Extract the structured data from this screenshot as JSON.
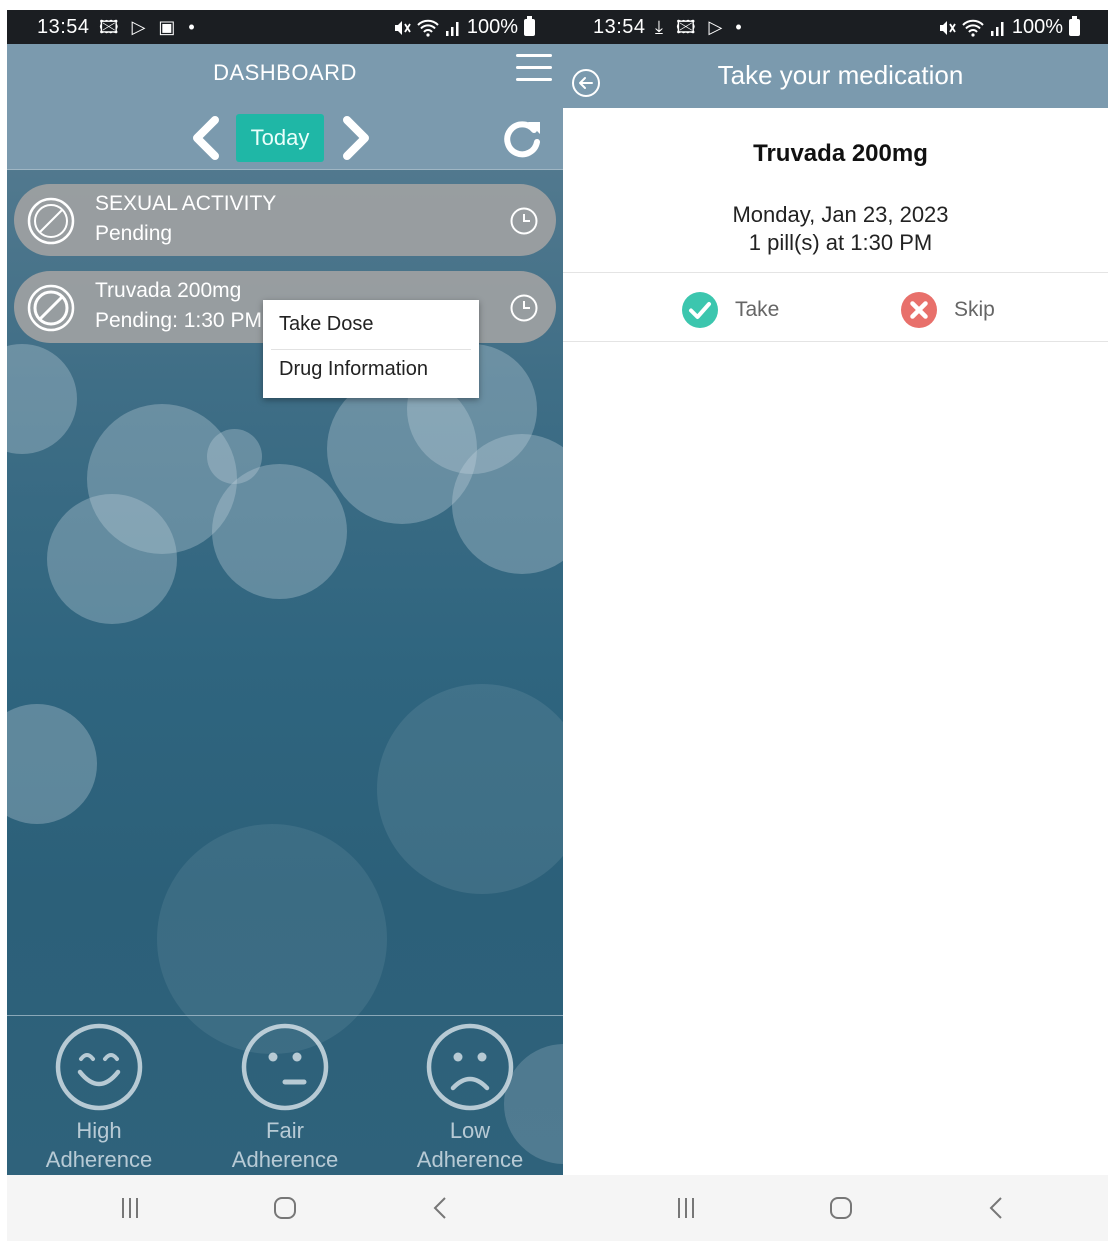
{
  "left_screen": {
    "status": {
      "time": "13:54",
      "left_icons": "🖾 ▷ ▣ •",
      "battery": "100%"
    },
    "header": {
      "title": "DASHBOARD",
      "today_label": "Today"
    },
    "medications": [
      {
        "name": "SEXUAL ACTIVITY",
        "status": "Pending"
      },
      {
        "name": "Truvada 200mg",
        "status": "Pending: 1:30 PM"
      }
    ],
    "context_menu": {
      "items": [
        "Take Dose",
        "Drug Information"
      ]
    },
    "adherence": [
      {
        "line1": "High",
        "line2": "Adherence",
        "icon": "smile-face-icon"
      },
      {
        "line1": "Fair",
        "line2": "Adherence",
        "icon": "neutral-face-icon"
      },
      {
        "line1": "Low",
        "line2": "Adherence",
        "icon": "sad-face-icon"
      }
    ]
  },
  "right_screen": {
    "status": {
      "time": "13:54",
      "left_icons": "⤓ 🖾 ▷ •",
      "battery": "100%"
    },
    "header": {
      "title": "Take your medication"
    },
    "drug": {
      "name": "Truvada 200mg",
      "date": "Monday, Jan 23, 2023",
      "dose": "1 pill(s) at 1:30 PM"
    },
    "actions": {
      "take_label": "Take",
      "skip_label": "Skip"
    }
  },
  "colors": {
    "header": "#7b9aae",
    "today_button": "#1fb7a6",
    "take_green": "#3cc6ae",
    "skip_red": "#e8706b",
    "status_bar": "#1b1e22"
  }
}
